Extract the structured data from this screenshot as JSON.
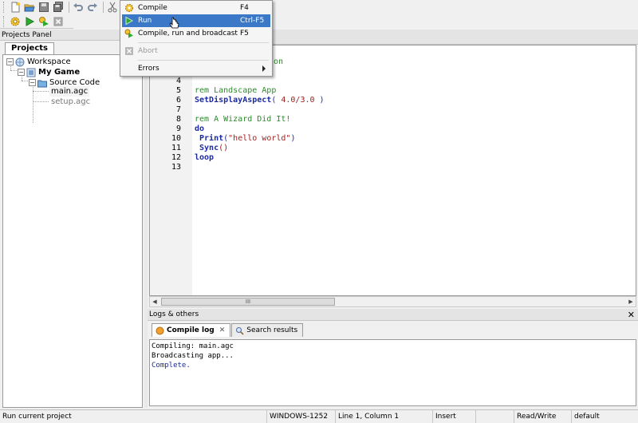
{
  "toolbar": {
    "icons": [
      "new-file-icon",
      "open-folder-icon",
      "save-icon",
      "save-all-icon",
      "undo-icon",
      "redo-icon",
      "cut-icon",
      "copy-icon"
    ],
    "build_icons": [
      "compile-gear-icon",
      "run-play-icon",
      "broadcast-icon",
      "abort-icon"
    ]
  },
  "menu": {
    "items": [
      {
        "label": "Compile",
        "shortcut": "F4"
      },
      {
        "label": "Run",
        "shortcut": "Ctrl-F5"
      },
      {
        "label": "Compile, run and broadcast",
        "shortcut": "F5"
      },
      {
        "label": "Abort",
        "shortcut": ""
      },
      {
        "label": "Errors",
        "shortcut": ""
      }
    ]
  },
  "projects_panel": {
    "title": "Projects Panel",
    "tab": "Projects",
    "tree": {
      "workspace": "Workspace",
      "project": "My Game",
      "folder": "Source Code",
      "files": [
        "main.agc",
        "setup.agc"
      ]
    }
  },
  "editor": {
    "line_numbers": [
      "4",
      "5",
      "6",
      "7",
      "8",
      "9",
      "10",
      "11",
      "12",
      "13"
    ],
    "top_fragment": "on",
    "lines": {
      "l5": "rem Landscape App",
      "l6_fn": "SetDisplayAspect",
      "l6_open": "( ",
      "l6_num": "4.0/3.0",
      "l6_close": " )",
      "l8": "rem A Wizard Did It!",
      "l9": "do",
      "l10_fn": " Print",
      "l10_open": "(",
      "l10_str": "\"hello world\"",
      "l10_close": ")",
      "l11_fn": " Sync",
      "l11_rest": "()",
      "l12": "loop"
    },
    "scroll_thumb": "III"
  },
  "logs": {
    "title": "Logs & others",
    "close": "✕",
    "tabs": [
      {
        "label": "Compile log",
        "close": "✕"
      },
      {
        "label": "Search results"
      }
    ],
    "lines": [
      "Compiling: main.agc",
      "Broadcasting app...",
      "Complete."
    ]
  },
  "status": {
    "message": "Run current project",
    "encoding": "WINDOWS-1252",
    "position": "Line 1, Column 1",
    "mode": "Insert",
    "access": "Read/Write",
    "profile": "default"
  },
  "colors": {
    "comment": "#2a8a2a",
    "keyword": "#1b2a9e",
    "string": "#a02020",
    "menu_highlight": "#3c78c8"
  }
}
